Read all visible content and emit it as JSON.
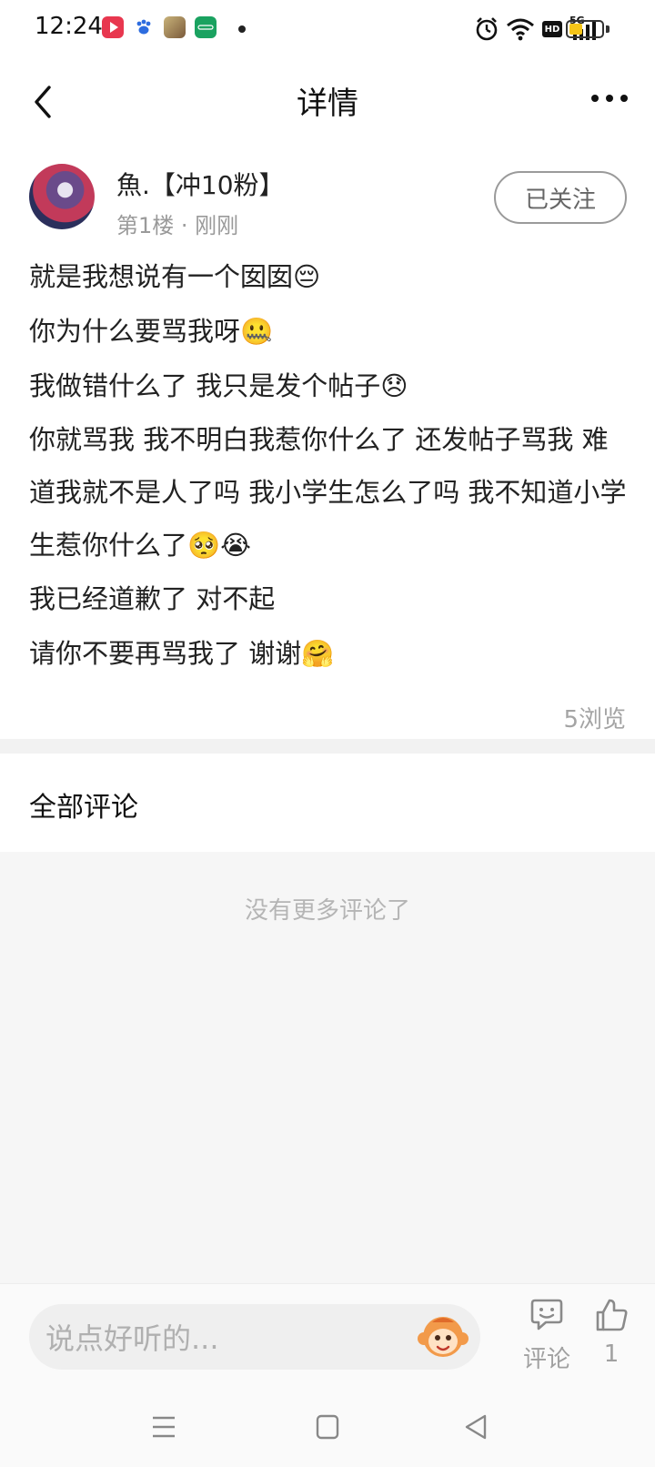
{
  "status_bar": {
    "time": "12:24",
    "network": "5G",
    "hd_badge": "HD",
    "battery_level": 0.4
  },
  "header": {
    "title": "详情"
  },
  "post": {
    "author": "魚.【冲10粉】",
    "meta": "第1楼 · 刚刚",
    "follow_label": "已关注",
    "lines": [
      "就是我想说有一个囡囡😔",
      "你为什么要骂我呀🤐",
      "我做错什么了  我只是发个帖子😞",
      "你就骂我  我不明白我惹你什么了  还发帖子骂我  难道我就不是人了吗  我小学生怎么了吗 我不知道小学生惹你什么了🥺😭",
      "我已经道歉了 对不起",
      "请你不要再骂我了 谢谢🤗"
    ],
    "views": "5浏览"
  },
  "comments": {
    "title": "全部评论",
    "empty_text": "没有更多评论了"
  },
  "bottom_bar": {
    "input_placeholder": "说点好听的...",
    "comment_label": "评论",
    "like_count": "1"
  },
  "colors": {
    "battery_fill": "#f5c518",
    "app_icon_red": "#e8374f",
    "app_icon_green": "#1aa260"
  }
}
